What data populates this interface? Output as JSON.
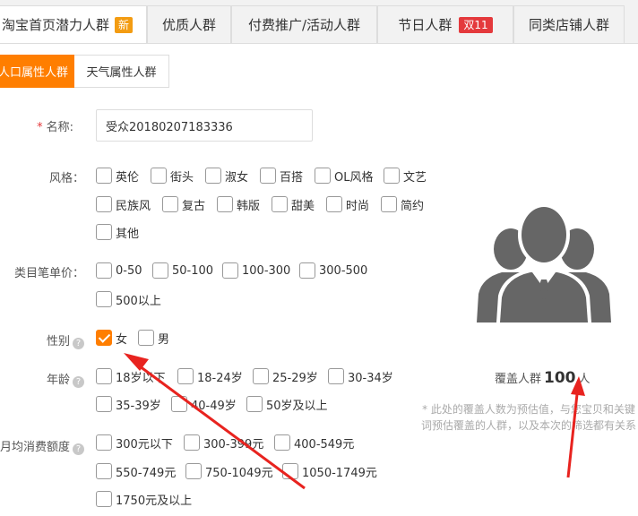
{
  "top_tabs": [
    {
      "label": "淘宝首页潜力人群",
      "badge": "新"
    },
    {
      "label": "优质人群"
    },
    {
      "label": "付费推广/活动人群"
    },
    {
      "label": "节日人群",
      "badge": "双11"
    },
    {
      "label": "同类店铺人群"
    }
  ],
  "sub_tabs": [
    {
      "label": "人口属性人群",
      "active": true
    },
    {
      "label": "天气属性人群",
      "active": false
    }
  ],
  "form": {
    "name": {
      "label": "名称:",
      "required_mark": "*",
      "value": "受众20180207183336"
    },
    "style": {
      "label": "风格：",
      "options": [
        {
          "label": "英伦",
          "checked": false
        },
        {
          "label": "街头",
          "checked": false
        },
        {
          "label": "淑女",
          "checked": false
        },
        {
          "label": "百搭",
          "checked": false
        },
        {
          "label": "OL风格",
          "checked": false
        },
        {
          "label": "文艺",
          "checked": false
        },
        {
          "label": "民族风",
          "checked": false
        },
        {
          "label": "复古",
          "checked": false
        },
        {
          "label": "韩版",
          "checked": false
        },
        {
          "label": "甜美",
          "checked": false
        },
        {
          "label": "时尚",
          "checked": false
        },
        {
          "label": "简约",
          "checked": false
        },
        {
          "label": "其他",
          "checked": false
        }
      ]
    },
    "category_price": {
      "label": "类目笔单价：",
      "options": [
        {
          "label": "0-50",
          "checked": false
        },
        {
          "label": "50-100",
          "checked": false
        },
        {
          "label": "100-300",
          "checked": false
        },
        {
          "label": "300-500",
          "checked": false
        },
        {
          "label": "500以上",
          "checked": false
        }
      ]
    },
    "gender": {
      "label": "性别",
      "help": "?",
      "options": [
        {
          "label": "女",
          "checked": true
        },
        {
          "label": "男",
          "checked": false
        }
      ]
    },
    "age": {
      "label": "年龄",
      "help": "?",
      "options": [
        {
          "label": "18岁以下",
          "checked": false
        },
        {
          "label": "18-24岁",
          "checked": false
        },
        {
          "label": "25-29岁",
          "checked": false
        },
        {
          "label": "30-34岁",
          "checked": false
        },
        {
          "label": "35-39岁",
          "checked": false
        },
        {
          "label": "40-49岁",
          "checked": false
        },
        {
          "label": "50岁及以上",
          "checked": false
        }
      ]
    },
    "monthly_spend": {
      "label": "月均消费额度",
      "help": "?",
      "options": [
        {
          "label": "300元以下",
          "checked": false
        },
        {
          "label": "300-399元",
          "checked": false
        },
        {
          "label": "400-549元",
          "checked": false
        },
        {
          "label": "550-749元",
          "checked": false
        },
        {
          "label": "750-1049元",
          "checked": false
        },
        {
          "label": "1050-1749元",
          "checked": false
        },
        {
          "label": "1750元及以上",
          "checked": false
        }
      ]
    }
  },
  "coverage": {
    "prefix": "覆盖人群",
    "count": "100",
    "unit": "人",
    "note": "* 此处的覆盖人数为预估值，与您宝贝和关键词预估覆盖的人群，以及本次的筛选都有关系"
  },
  "colors": {
    "accent": "#ff7e00",
    "badge_red": "#e4393c",
    "arrow": "#e8231f",
    "icon_gray": "#666666"
  }
}
